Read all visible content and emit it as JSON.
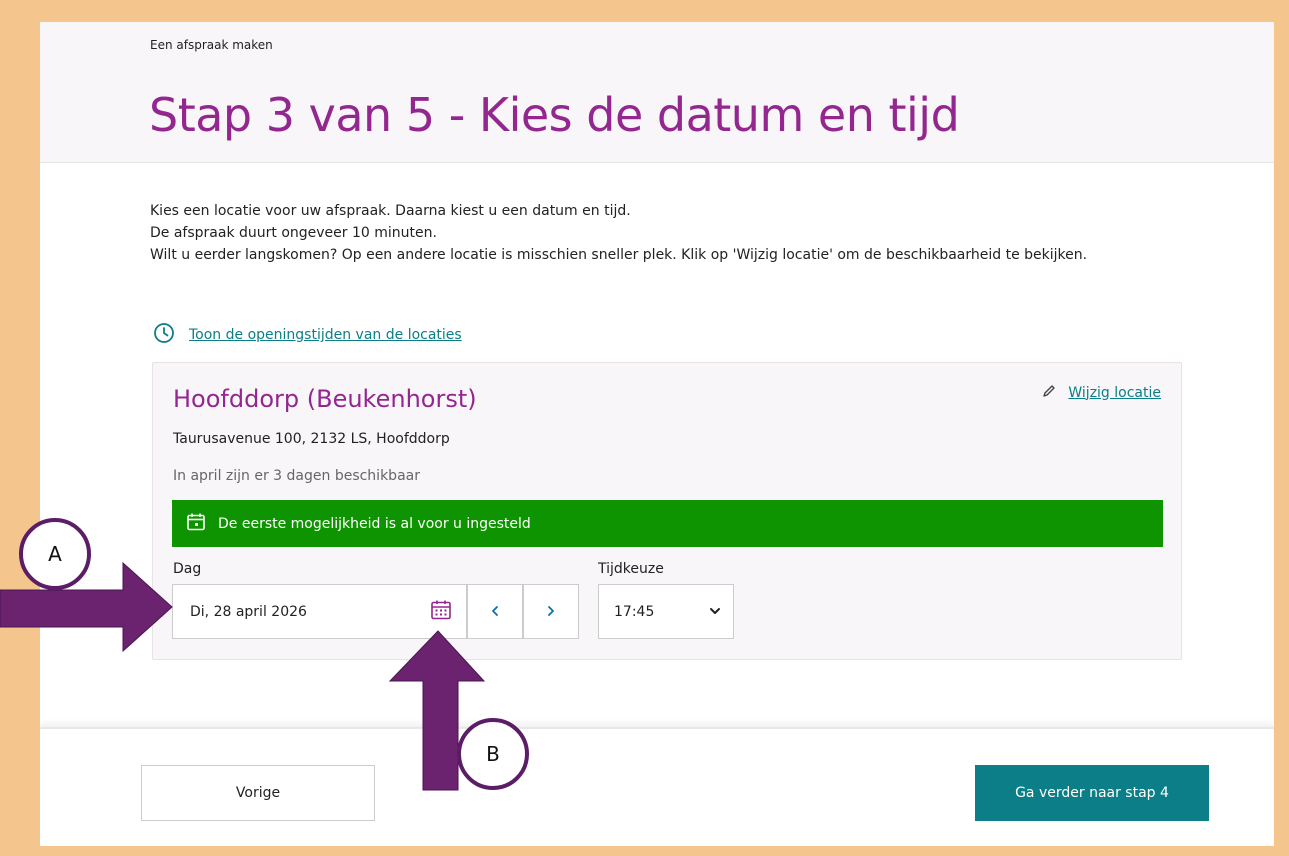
{
  "header": {
    "breadcrumb": "Een afspraak maken",
    "title": "Stap 3 van 5 - Kies de datum en tijd"
  },
  "intro": {
    "lines": [
      "Kies een locatie voor uw afspraak. Daarna kiest u een datum en tijd.",
      "De afspraak duurt ongeveer 10 minuten.",
      "Wilt u eerder langskomen? Op een andere locatie is misschien sneller plek. Klik op 'Wijzig locatie' om de beschikbaarheid te bekijken."
    ]
  },
  "hours_link": {
    "label": "Toon de openingstijden van de locaties",
    "icon": "clock-icon"
  },
  "location": {
    "name": "Hoofddorp (Beukenhorst)",
    "change_label": "Wijzig locatie",
    "address": "Taurusavenue 100, 2132 LS, Hoofddorp",
    "availability": "In april zijn er 3 dagen beschikbaar",
    "notice": "De eerste mogelijkheid is al voor u ingesteld"
  },
  "date_picker": {
    "label": "Dag",
    "value": "Di, 28 april 2026",
    "prev_icon": "chevron-left-icon",
    "next_icon": "chevron-right-icon"
  },
  "time_picker": {
    "label": "Tijdkeuze",
    "value": "17:45"
  },
  "footer": {
    "prev_label": "Vorige",
    "next_label": "Ga verder naar stap 4"
  },
  "annotations": {
    "a": "A",
    "b": "B"
  },
  "colors": {
    "frame": "#f5c58e",
    "title": "#93278f",
    "link": "#0b7e88",
    "notice": "#0e9400",
    "arrow": "#6b2370"
  }
}
